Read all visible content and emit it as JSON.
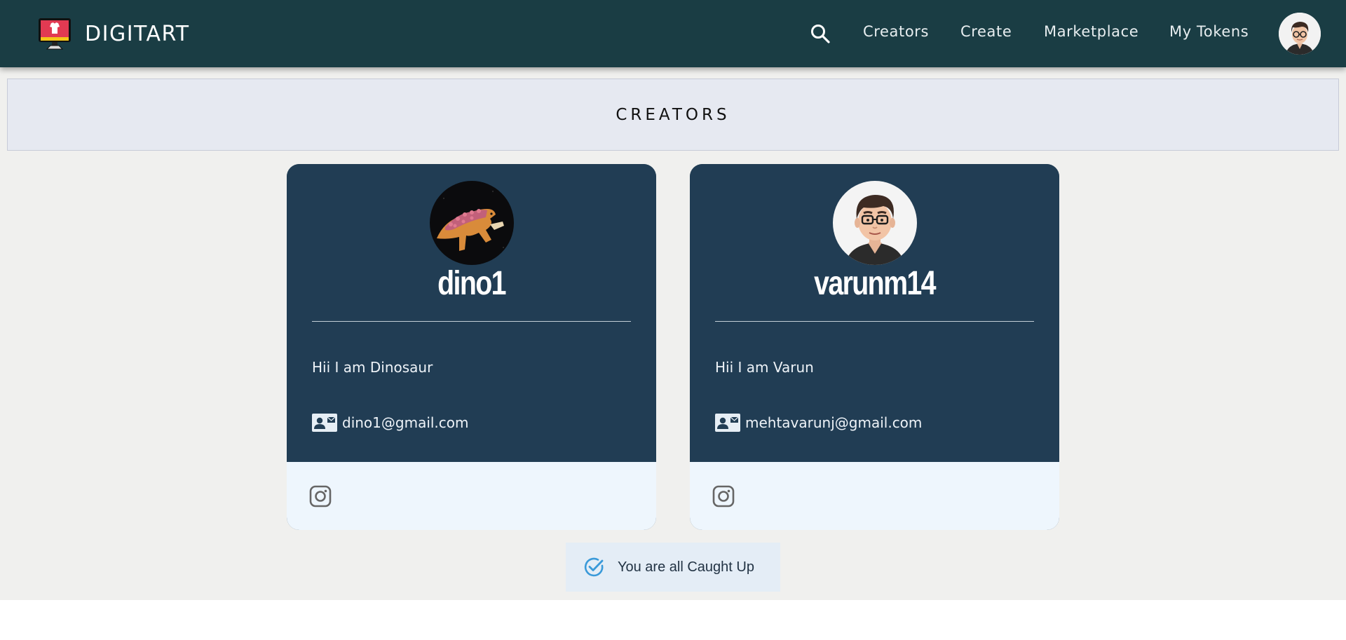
{
  "app": {
    "name": "DIGITART"
  },
  "nav": {
    "links": [
      "Creators",
      "Create",
      "Marketplace",
      "My Tokens"
    ]
  },
  "page": {
    "title": "CREATORS"
  },
  "creators": [
    {
      "username": "dino1",
      "bio": "Hii I am Dinosaur",
      "email": "dino1@gmail.com"
    },
    {
      "username": "varunm14",
      "bio": "Hii I am Varun",
      "email": "mehtavarunj@gmail.com"
    }
  ],
  "status": {
    "caught_up": "You are all Caught Up"
  },
  "colors": {
    "navbar": "#1a3d44",
    "card": "#213d54",
    "card_footer": "#eef6fd",
    "banner": "#e6e9f1",
    "check_accent": "#3a9ad9"
  }
}
